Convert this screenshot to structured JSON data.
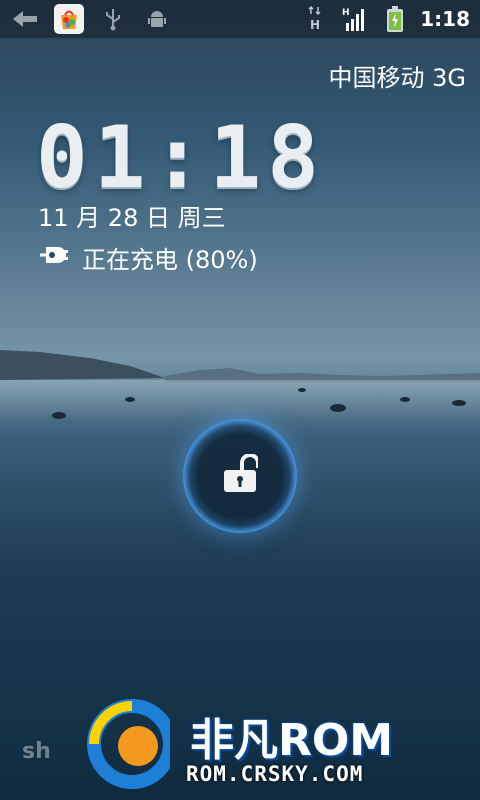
{
  "status_bar": {
    "icons_left": [
      "back-arrow-icon",
      "app-store-icon",
      "usb-icon",
      "android-debug-icon"
    ],
    "icons_right": [
      "data-h-icon",
      "signal-h-icon",
      "battery-charging-icon"
    ],
    "time": "1:18",
    "signal_level": 0.9,
    "battery_level": 0.8
  },
  "carrier": "中国移动 3G",
  "clock": "01:18",
  "date": "11 月 28 日 周三",
  "charging": {
    "icon": "charger-plug-icon",
    "text": "正在充电 (80%)"
  },
  "unlock": {
    "icon": "unlocked-padlock-icon",
    "accent": "#5aa8ff"
  },
  "watermark": {
    "brand": "非凡ROM",
    "url": "ROM.CRSKY.COM"
  }
}
